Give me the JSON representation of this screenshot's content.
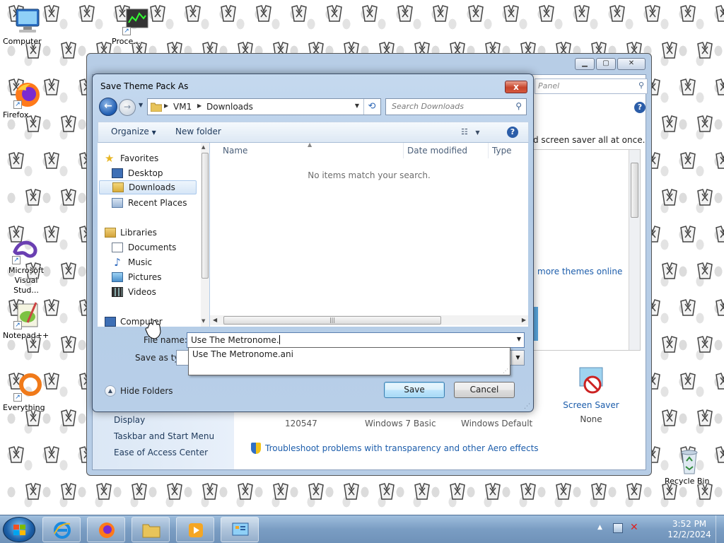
{
  "desktop": {
    "icons": [
      {
        "label": "Computer"
      },
      {
        "label": "Proce..."
      },
      {
        "label": "Firefox"
      },
      {
        "label": "Microsoft Visual Stud..."
      },
      {
        "label": "Notepad++"
      },
      {
        "label": "Everything"
      },
      {
        "label": "Recycle Bin"
      }
    ]
  },
  "control_panel": {
    "search_placeholder": "Panel",
    "description": "d screen saver all at once.",
    "more_themes_link": "more themes online",
    "sidebar_links": [
      "Display",
      "Taskbar and Start Menu",
      "Ease of Access Center"
    ],
    "themes": [
      {
        "label": "120547"
      },
      {
        "label": "Windows 7 Basic"
      },
      {
        "label": "Windows Default"
      }
    ],
    "screen_saver": {
      "title": "Screen Saver",
      "value": "None"
    },
    "troubleshoot_link": "Troubleshoot problems with transparency and other Aero effects"
  },
  "dialog": {
    "title": "Save Theme Pack As",
    "close_label": "x",
    "breadcrumb": [
      "VM1",
      "Downloads"
    ],
    "search_placeholder": "Search Downloads",
    "toolbar": {
      "organize": "Organize",
      "new_folder": "New folder"
    },
    "nav": {
      "favorites_header": "Favorites",
      "favorites": [
        "Desktop",
        "Downloads",
        "Recent Places"
      ],
      "selected": "Downloads",
      "libraries_header": "Libraries",
      "libraries": [
        "Documents",
        "Music",
        "Pictures",
        "Videos"
      ],
      "computer_header": "Computer"
    },
    "columns": [
      "Name",
      "Date modified",
      "Type"
    ],
    "empty_message": "No items match your search.",
    "file_name_label": "File name:",
    "file_name_value": "Use The Metronome.",
    "save_type_label": "Save as type:",
    "autocomplete": [
      "Use The Metronome.ani"
    ],
    "hide_folders": "Hide Folders",
    "save_button": "Save",
    "cancel_button": "Cancel"
  },
  "taskbar": {
    "time": "3:52 PM",
    "date": "12/2/2024"
  },
  "colors": {
    "accent": "#1c5dab",
    "taskbar": "#7a9dc3",
    "dialog_frame": "#b3cbe6"
  }
}
